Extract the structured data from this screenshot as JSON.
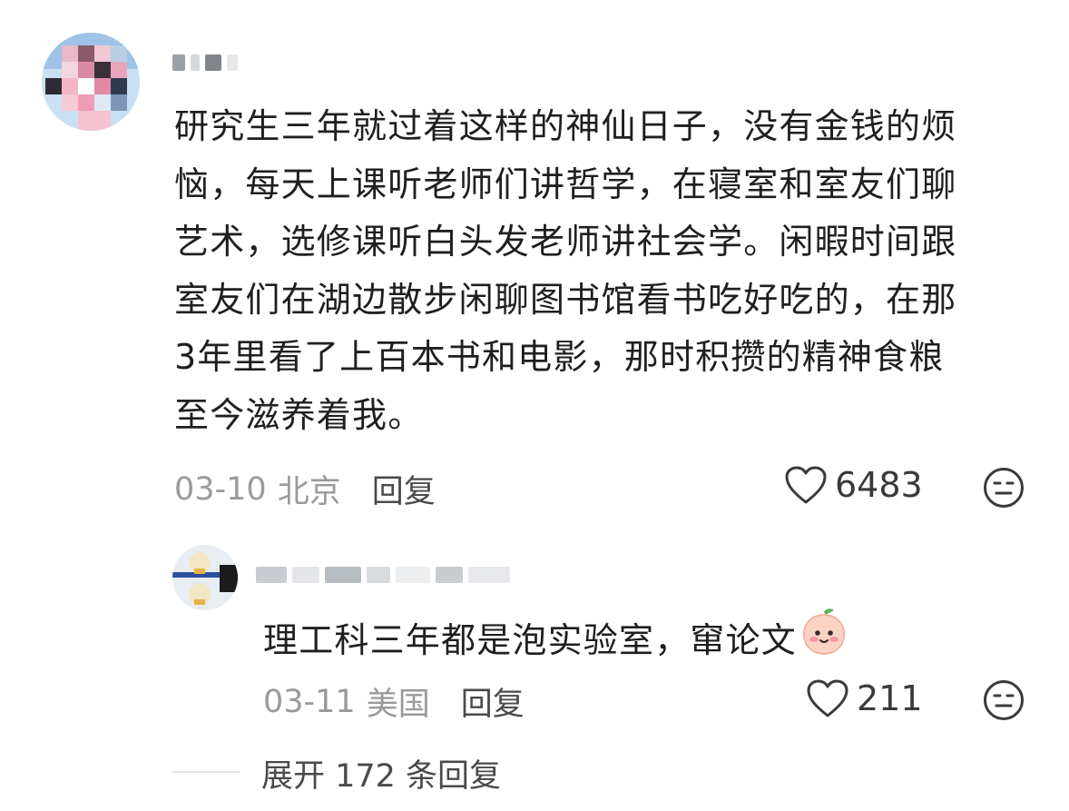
{
  "main_comment": {
    "text": "研究生三年就过着这样的神仙日子，没有金钱的烦\n恼，每天上课听老师们讲哲学，在寝室和室友们聊\n艺术，选修课听白头发老师讲社会学。闲暇时间跟\n室友们在湖边散步闲聊图书馆看书吃好吃的，在那\n3年里看了上百本书和电影，那时积攒的精神食粮\n至今滋养着我。",
    "date": "03-10",
    "location": "北京",
    "reply_label": "回复",
    "like_count": "6483"
  },
  "reply_comment": {
    "text": "理工科三年都是泡实验室，窜论文",
    "date": "03-11",
    "location": "美国",
    "reply_label": "回复",
    "like_count": "211"
  },
  "expand_replies": "展开 172 条回复",
  "icons": {
    "like": "heart-outline-icon",
    "react": "neutral-face-icon",
    "emoji": "peach-face-emoji"
  },
  "colors": {
    "text": "#1f1f1f",
    "meta": "#9a9a9a",
    "action": "#4a4a4a",
    "background": "#ffffff"
  }
}
